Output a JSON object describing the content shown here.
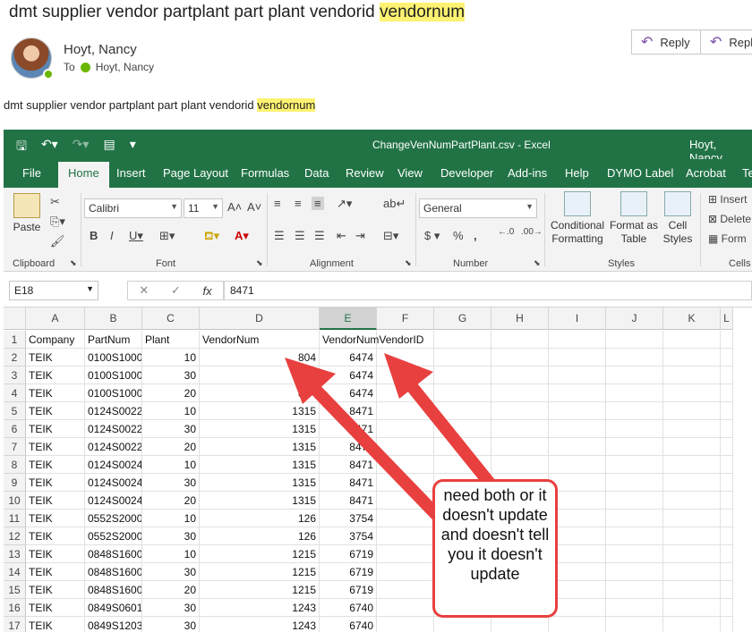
{
  "email": {
    "subject_plain": "dmt supplier vendor partplant part plant vendorid ",
    "subject_hl": "vendornum",
    "sender": "Hoyt, Nancy",
    "to_label": "To",
    "to_name": "Hoyt, Nancy",
    "reply_label": "Reply",
    "reply_all_label": "Repl",
    "body_plain": "dmt supplier vendor partplant part plant vendorid ",
    "body_hl": "vendornum"
  },
  "excel": {
    "doc_title": "ChangeVenNumPartPlant.csv  -  Excel",
    "user": "Hoyt, Nancy",
    "tabs": [
      "File",
      "Home",
      "Insert",
      "Page Layout",
      "Formulas",
      "Data",
      "Review",
      "View",
      "Developer",
      "Add-ins",
      "Help",
      "DYMO Label",
      "Acrobat",
      "Te"
    ],
    "ribbon": {
      "paste": "Paste",
      "font_name": "Calibri",
      "font_size": "11",
      "number_format": "General",
      "cond_fmt_1": "Conditional",
      "cond_fmt_2": "Formatting",
      "fmt_table_1": "Format as",
      "fmt_table_2": "Table",
      "cell_styles_1": "Cell",
      "cell_styles_2": "Styles",
      "insert": "Insert",
      "delete": "Delete",
      "format": "Form",
      "groups": {
        "clipboard": "Clipboard",
        "font": "Font",
        "alignment": "Alignment",
        "number": "Number",
        "styles": "Styles",
        "cells": "Cells"
      }
    },
    "name_box": "E18",
    "formula_value": "8471",
    "columns": [
      "A",
      "B",
      "C",
      "D",
      "E",
      "F",
      "G",
      "H",
      "I",
      "J",
      "K",
      "L"
    ],
    "rows": [
      {
        "n": "1",
        "a": "Company",
        "b": "PartNum",
        "c": "Plant",
        "d": "VendorNum",
        "e": "VendorNumVendorID"
      },
      {
        "n": "2",
        "a": "TEIK",
        "b": "0100S1000",
        "c": "10",
        "d": "804",
        "e": "6474"
      },
      {
        "n": "3",
        "a": "TEIK",
        "b": "0100S1000",
        "c": "30",
        "d": "804",
        "e": "6474"
      },
      {
        "n": "4",
        "a": "TEIK",
        "b": "0100S1000",
        "c": "20",
        "d": "804",
        "e": "6474"
      },
      {
        "n": "5",
        "a": "TEIK",
        "b": "0124S0022",
        "c": "10",
        "d": "1315",
        "e": "8471"
      },
      {
        "n": "6",
        "a": "TEIK",
        "b": "0124S0022",
        "c": "30",
        "d": "1315",
        "e": "8471"
      },
      {
        "n": "7",
        "a": "TEIK",
        "b": "0124S0022",
        "c": "20",
        "d": "1315",
        "e": "8471"
      },
      {
        "n": "8",
        "a": "TEIK",
        "b": "0124S0024",
        "c": "10",
        "d": "1315",
        "e": "8471"
      },
      {
        "n": "9",
        "a": "TEIK",
        "b": "0124S0024",
        "c": "30",
        "d": "1315",
        "e": "8471"
      },
      {
        "n": "10",
        "a": "TEIK",
        "b": "0124S0024",
        "c": "20",
        "d": "1315",
        "e": "8471"
      },
      {
        "n": "11",
        "a": "TEIK",
        "b": "0552S2000",
        "c": "10",
        "d": "126",
        "e": "3754"
      },
      {
        "n": "12",
        "a": "TEIK",
        "b": "0552S2000",
        "c": "30",
        "d": "126",
        "e": "3754"
      },
      {
        "n": "13",
        "a": "TEIK",
        "b": "0848S1600",
        "c": "10",
        "d": "1215",
        "e": "6719"
      },
      {
        "n": "14",
        "a": "TEIK",
        "b": "0848S1600",
        "c": "30",
        "d": "1215",
        "e": "6719"
      },
      {
        "n": "15",
        "a": "TEIK",
        "b": "0848S1600",
        "c": "20",
        "d": "1215",
        "e": "6719"
      },
      {
        "n": "16",
        "a": "TEIK",
        "b": "0849S0601",
        "c": "30",
        "d": "1243",
        "e": "6740"
      },
      {
        "n": "17",
        "a": "TEIK",
        "b": "0849S1203",
        "c": "30",
        "d": "1243",
        "e": "6740"
      }
    ]
  },
  "annotation": {
    "callout_text": "need both or it doesn't update and doesn't tell you it doesn't update",
    "color": "#e8403f"
  },
  "colors": {
    "excel_green": "#217346",
    "highlight": "#fdf271",
    "presence": "#6bb700"
  }
}
